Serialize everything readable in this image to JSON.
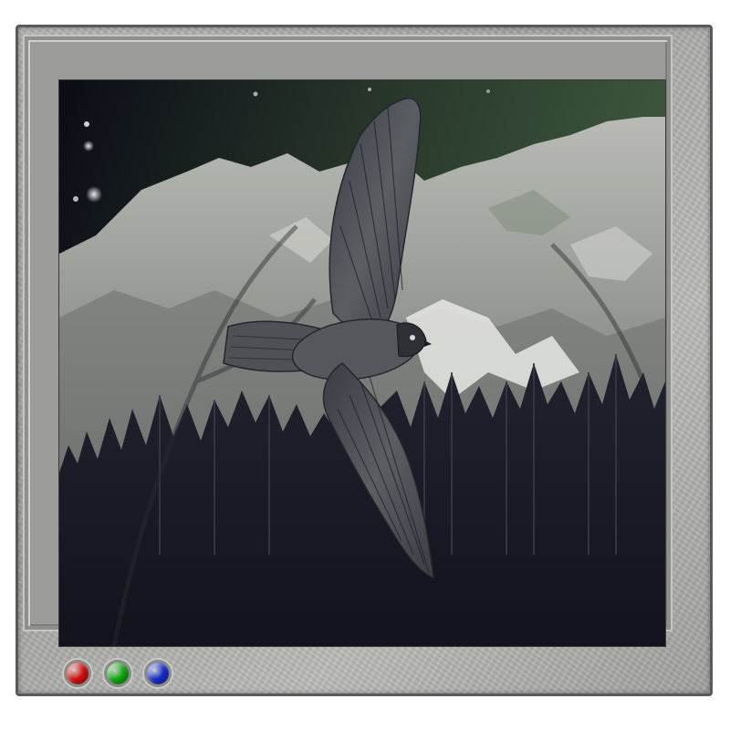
{
  "device": {
    "buttons": [
      {
        "name": "red-button",
        "color": "#e01010"
      },
      {
        "name": "green-button",
        "color": "#12b012"
      },
      {
        "name": "blue-button",
        "color": "#1a2fd6"
      }
    ]
  },
  "screen": {
    "scene": [
      "night-sky",
      "mountains",
      "flying-hawk",
      "pine-forest"
    ]
  }
}
